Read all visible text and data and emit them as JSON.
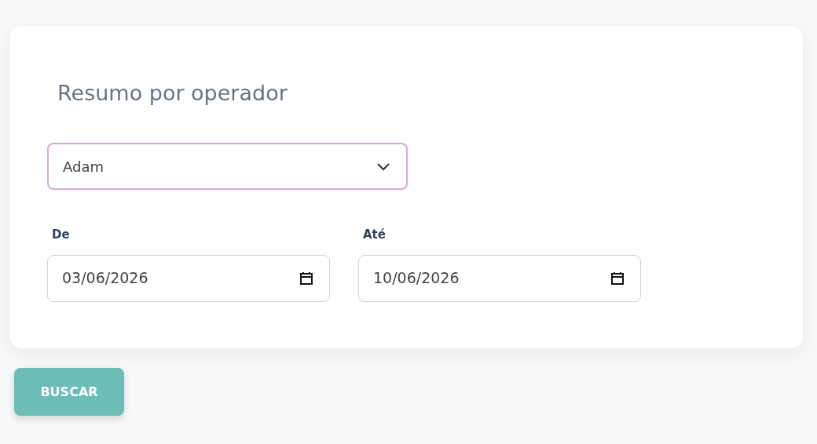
{
  "title": "Resumo por operador",
  "operator_select": {
    "value": "Adam"
  },
  "date_fields": [
    {
      "label": "De",
      "value": "03/06/2026"
    },
    {
      "label": "Até",
      "value": "10/06/2026"
    }
  ],
  "search_button": {
    "label": "BUSCAR"
  }
}
